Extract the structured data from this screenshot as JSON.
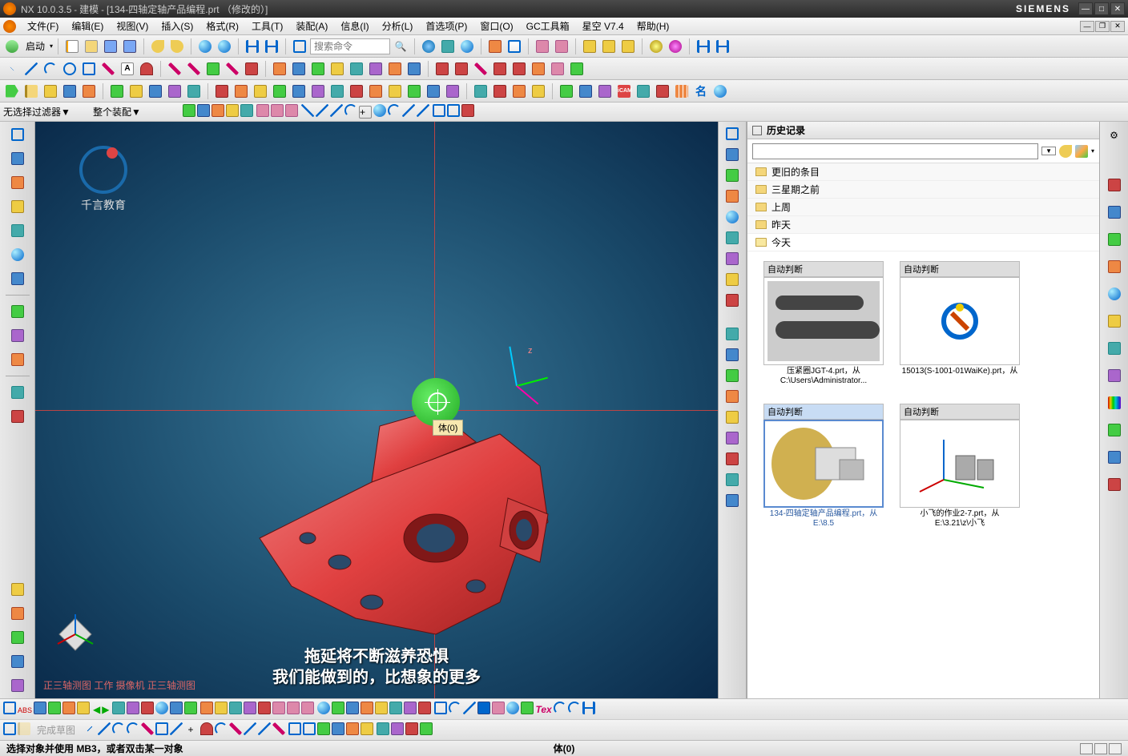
{
  "title_bar": {
    "app": "NX 10.0.3.5",
    "context": "建模",
    "document": "[134-四轴定轴产品编程.prt （修改的）]",
    "brand": "SIEMENS"
  },
  "menu": {
    "items": [
      "文件(F)",
      "编辑(E)",
      "视图(V)",
      "插入(S)",
      "格式(R)",
      "工具(T)",
      "装配(A)",
      "信息(I)",
      "分析(L)",
      "首选项(P)",
      "窗口(O)",
      "GC工具箱",
      "星空 V7.4",
      "帮助(H)"
    ]
  },
  "toolbar1": {
    "start": "启动",
    "search_placeholder": "搜索命令"
  },
  "filter": {
    "no_selection": "无选择过滤器",
    "assembly": "整个装配"
  },
  "viewport": {
    "logo_text": "千言教育",
    "tooltip": "体(0)",
    "subtitle1": "拖延将不断滋养恐惧",
    "subtitle2": "我们能做到的，比想象的更多",
    "view_label": "正三轴测图  工作  摄像机  正三轴测图",
    "z_label": "z"
  },
  "history": {
    "title": "历史记录",
    "folders": [
      "更旧的条目",
      "三星期之前",
      "上周",
      "昨天",
      "今天"
    ],
    "thumb_header": "自动判断",
    "thumbs": [
      {
        "caption": "压紧圈JGT-4.prt，从 C:\\Users\\Administrator..."
      },
      {
        "caption": "15013(S-1001-01WaiKe).prt，从"
      },
      {
        "caption": "134-四轴定轴产品编程.prt，从 E:\\8.5",
        "selected": true
      },
      {
        "caption": "小飞的作业2-7.prt，从 E:\\3.21\\z\\小飞"
      }
    ]
  },
  "bottom_toolbar": {
    "finish_sketch": "完成草图"
  },
  "status": {
    "left": "选择对象并使用 MB3，或者双击某一对象",
    "center": "体(0)"
  },
  "icon_letter": {
    "A": "A",
    "name": "名"
  }
}
